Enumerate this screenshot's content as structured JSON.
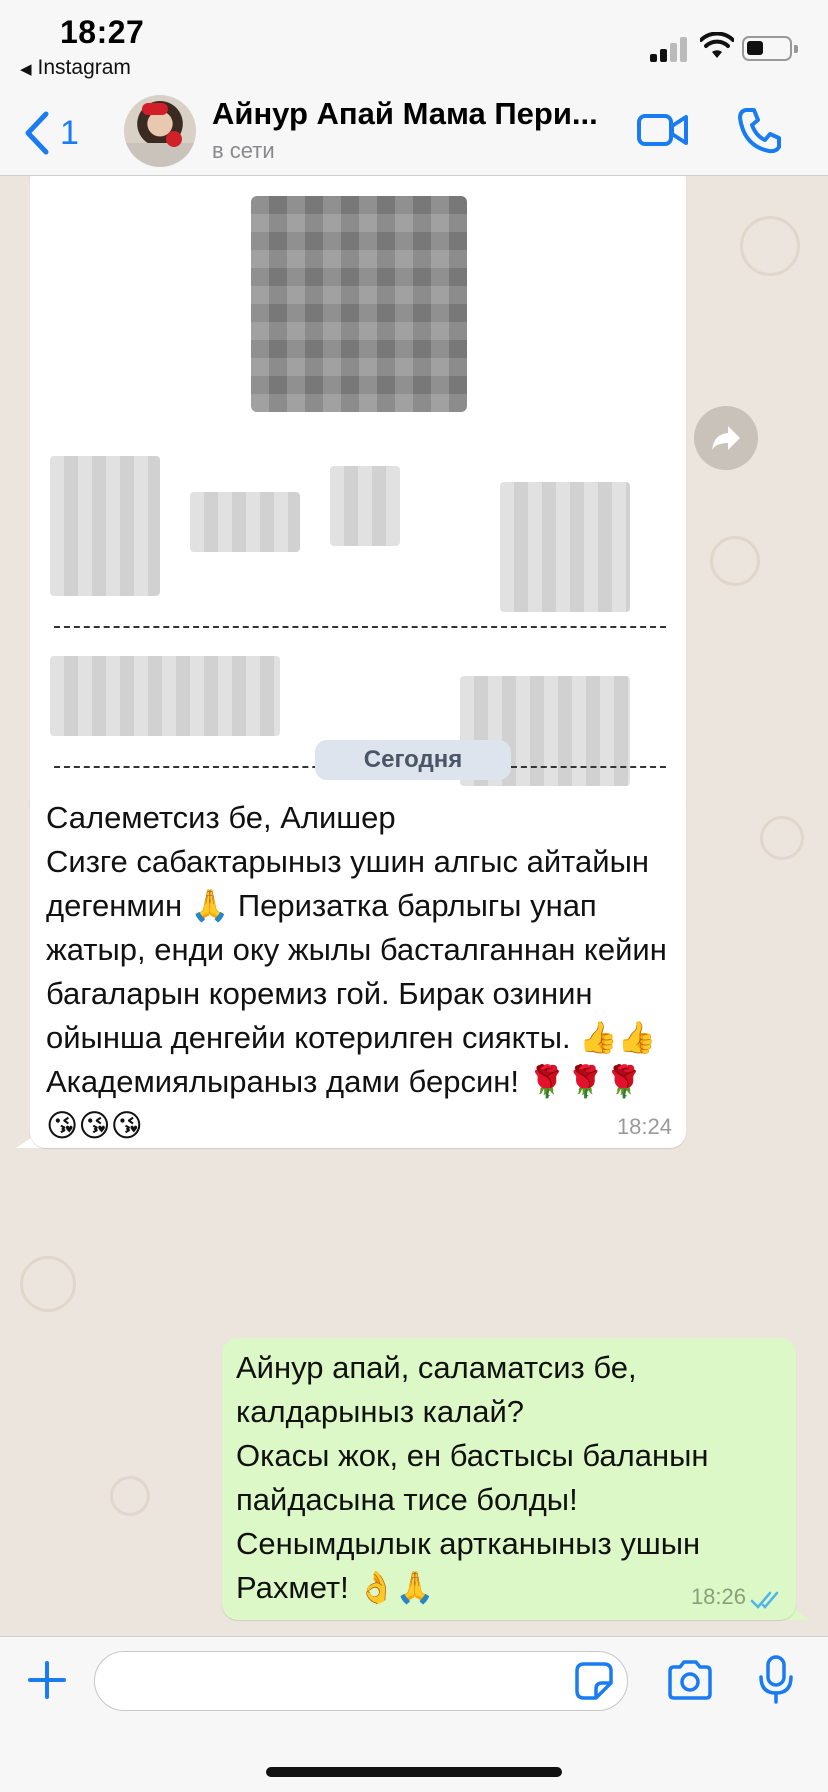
{
  "status_bar": {
    "time": "18:27",
    "back_app": "Instagram",
    "icons": [
      "cellular-signal-icon",
      "wifi-icon",
      "battery-icon"
    ]
  },
  "header": {
    "back_count": "1",
    "contact_name": "Айнур Апай Мама Пери...",
    "status": "в сети",
    "icons": [
      "video-call-icon",
      "phone-call-icon"
    ]
  },
  "chat": {
    "date_divider": "Сегодня",
    "messages": [
      {
        "direction": "incoming",
        "text": "Салеметсиз бе, Алишер\nСизге сабактарыныз ушин алгыс айтайын дегенмин 🙏 Перизатка барлыгы унап жатыр, енди оку жылы басталганнан кейин багаларын коремиз гой. Бирак озинин ойынша денгейи котерилген сиякты. 👍👍\nАкадемиялыраныз дами берсин! 🌹🌹🌹😘😘😘",
        "time": "18:24"
      },
      {
        "direction": "outgoing",
        "text": "Айнур апай, саламатсиз бе, калдарыныз калай?\nОкасы жок, ен бастысы баланын пайдасына тисе болды!\nСенымдылык артканыныз ушын Рахмет! 👌🙏",
        "time": "18:26",
        "read": true
      }
    ]
  },
  "input": {
    "placeholder": "",
    "value": "",
    "icons": [
      "plus-icon",
      "sticker-icon",
      "camera-icon",
      "microphone-icon"
    ]
  }
}
